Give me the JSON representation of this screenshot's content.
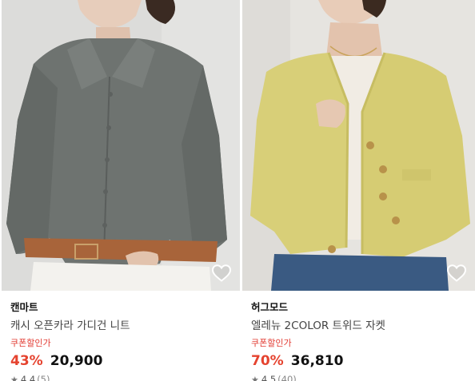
{
  "products": [
    {
      "brand": "캔마트",
      "name": "캐시 오픈카라 가디건 니트",
      "coupon_label": "쿠폰할인가",
      "discount": "43%",
      "price": "20,900",
      "rating": "4.4",
      "review_count": "(5)"
    },
    {
      "brand": "허그모드",
      "name": "엘레뉴 2COLOR 트위드 자켓",
      "coupon_label": "쿠폰할인가",
      "discount": "70%",
      "price": "36,810",
      "rating": "4.5",
      "review_count": "(40)"
    }
  ],
  "colors": {
    "discount": "#e5432f",
    "coupon": "#e23b32",
    "cardigan": "#6f7370",
    "jacket": "#d8cf78",
    "photo_bg_left": "#d9d9d7",
    "photo_bg_right": "#e4e2de"
  },
  "icons": {
    "wishlist": "heart-outline-icon",
    "rating": "star-icon"
  }
}
